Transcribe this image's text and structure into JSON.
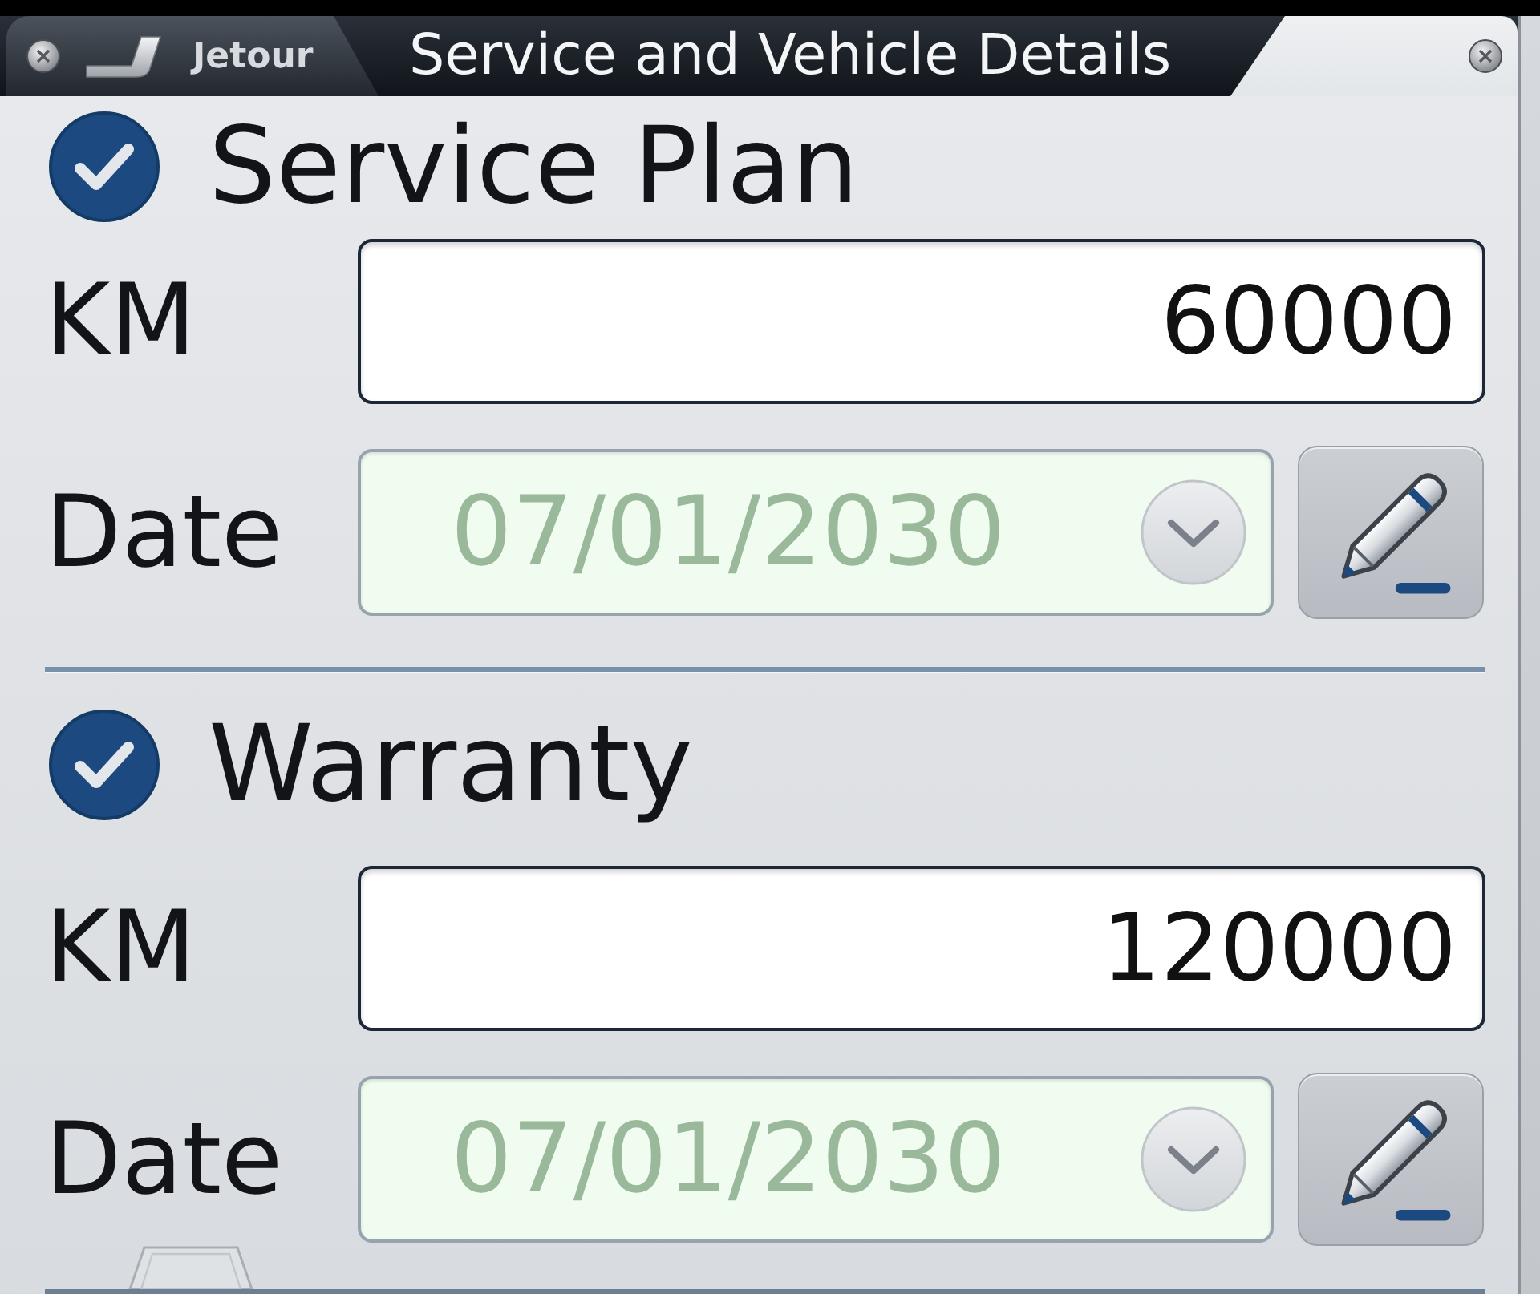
{
  "window": {
    "brand": "Jetour",
    "title": "Service and Vehicle Details"
  },
  "sections": [
    {
      "title": "Service Plan",
      "checked": true,
      "fields": [
        {
          "kind": "number",
          "label": "KM",
          "value": "60000"
        },
        {
          "kind": "date",
          "label": "Date",
          "value": "07/01/2030"
        }
      ]
    },
    {
      "title": "Warranty",
      "checked": true,
      "fields": [
        {
          "kind": "number",
          "label": "KM",
          "value": "120000"
        },
        {
          "kind": "date",
          "label": "Date",
          "value": "07/01/2030"
        }
      ]
    }
  ]
}
